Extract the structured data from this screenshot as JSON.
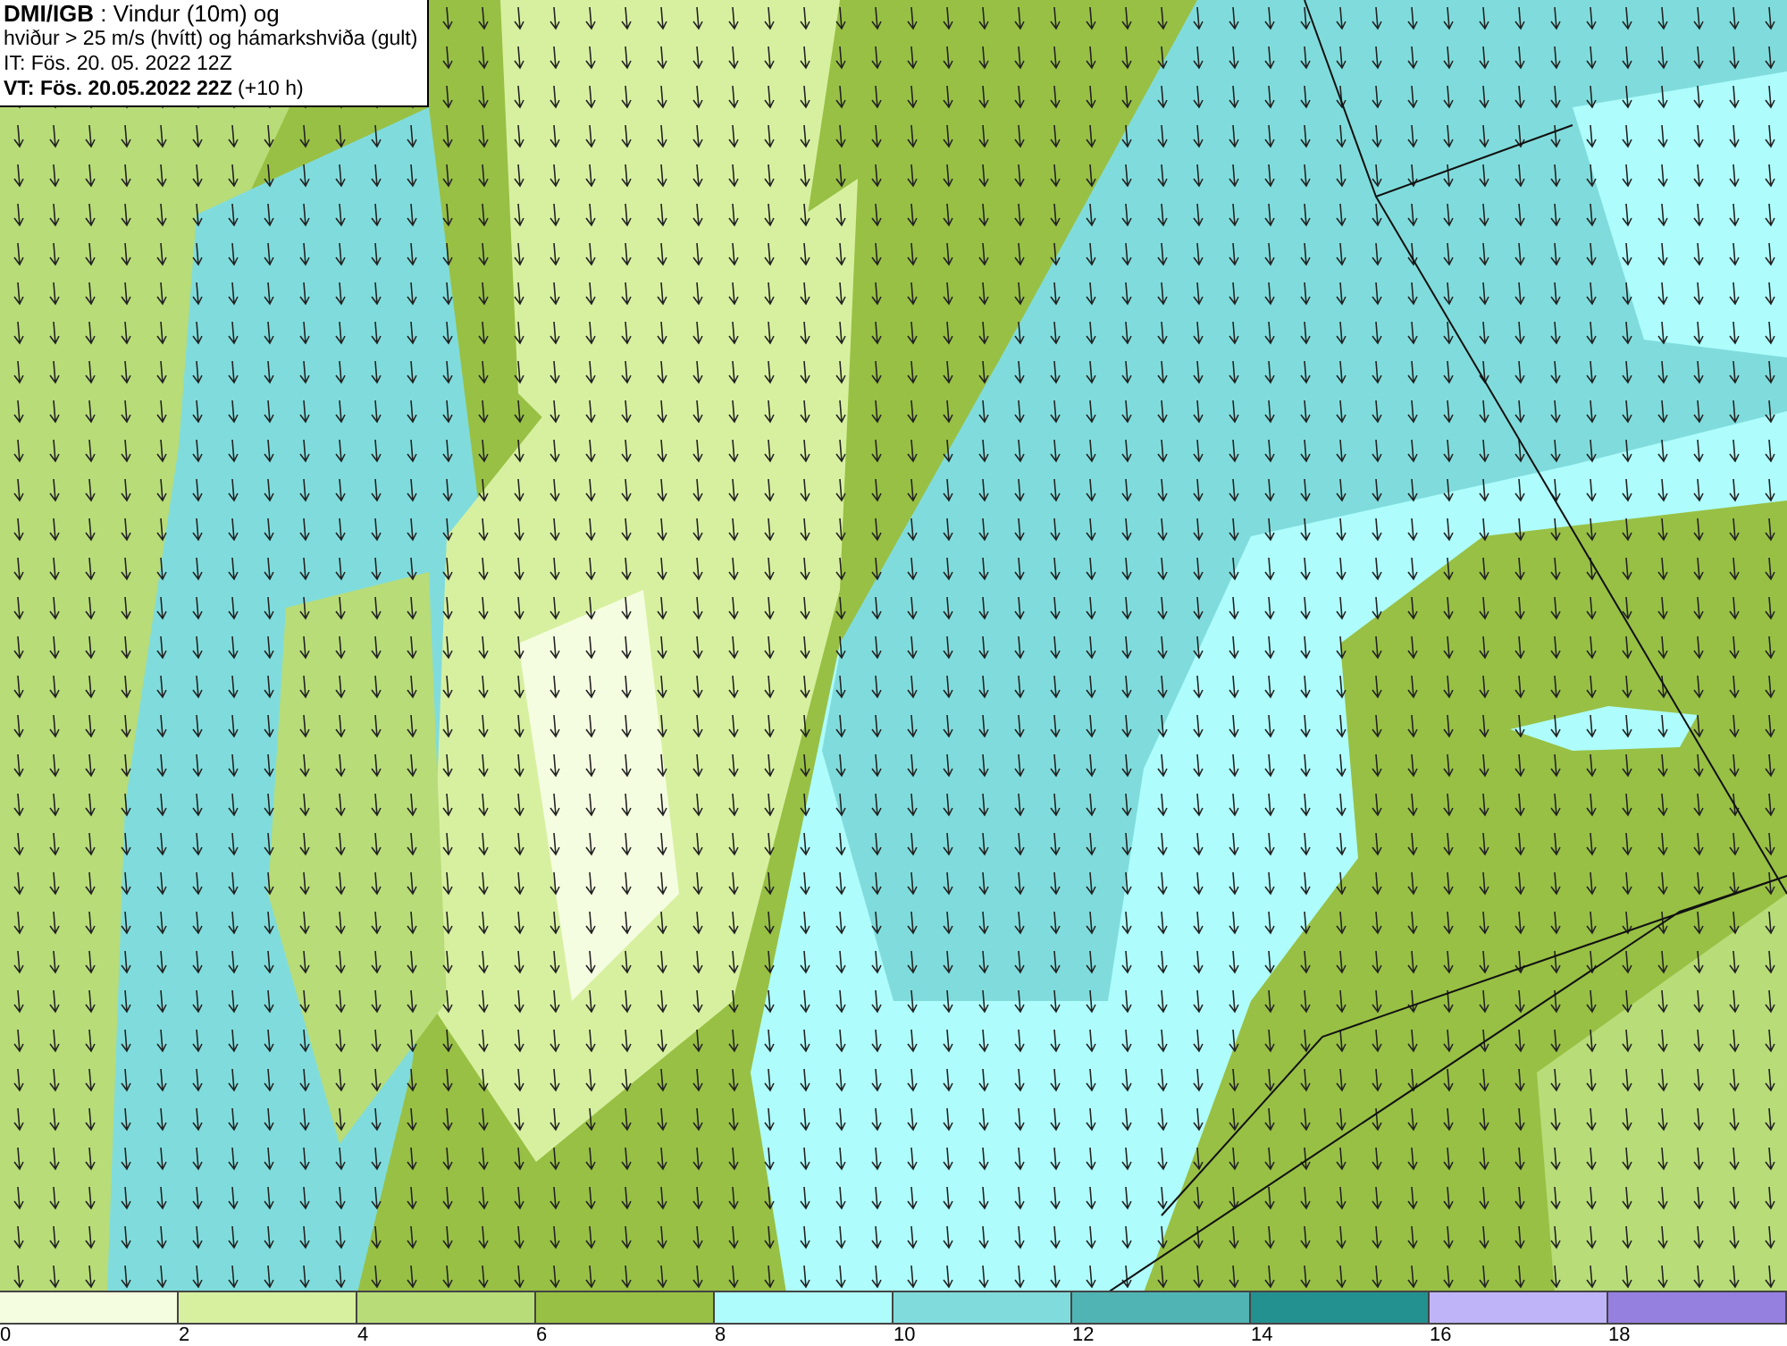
{
  "title_box": {
    "lines": [
      "**DMI/IGB** : Vindur (10m) og",
      "hviður > 25 m/s (hvítt) og hámarkshviða (gult)",
      "IT: Fös. 20. 05. 2022 12Z",
      "**VT: Fös. 20.05.2022 22Z** (+10 h)"
    ]
  },
  "legend": {
    "bins": [
      {
        "label": "0",
        "color": "#f5fde0"
      },
      {
        "label": "2",
        "color": "#d7f0a0"
      },
      {
        "label": "4",
        "color": "#b8dc78"
      },
      {
        "label": "6",
        "color": "#98c044"
      },
      {
        "label": "8",
        "color": "#aefcfc"
      },
      {
        "label": "10",
        "color": "#80dcdc"
      },
      {
        "label": "12",
        "color": "#50b4b4"
      },
      {
        "label": "14",
        "color": "#23918f"
      },
      {
        "label": "16",
        "color": "#c0b4f8"
      },
      {
        "label": "18",
        "color": "#9580e0"
      }
    ]
  }
}
